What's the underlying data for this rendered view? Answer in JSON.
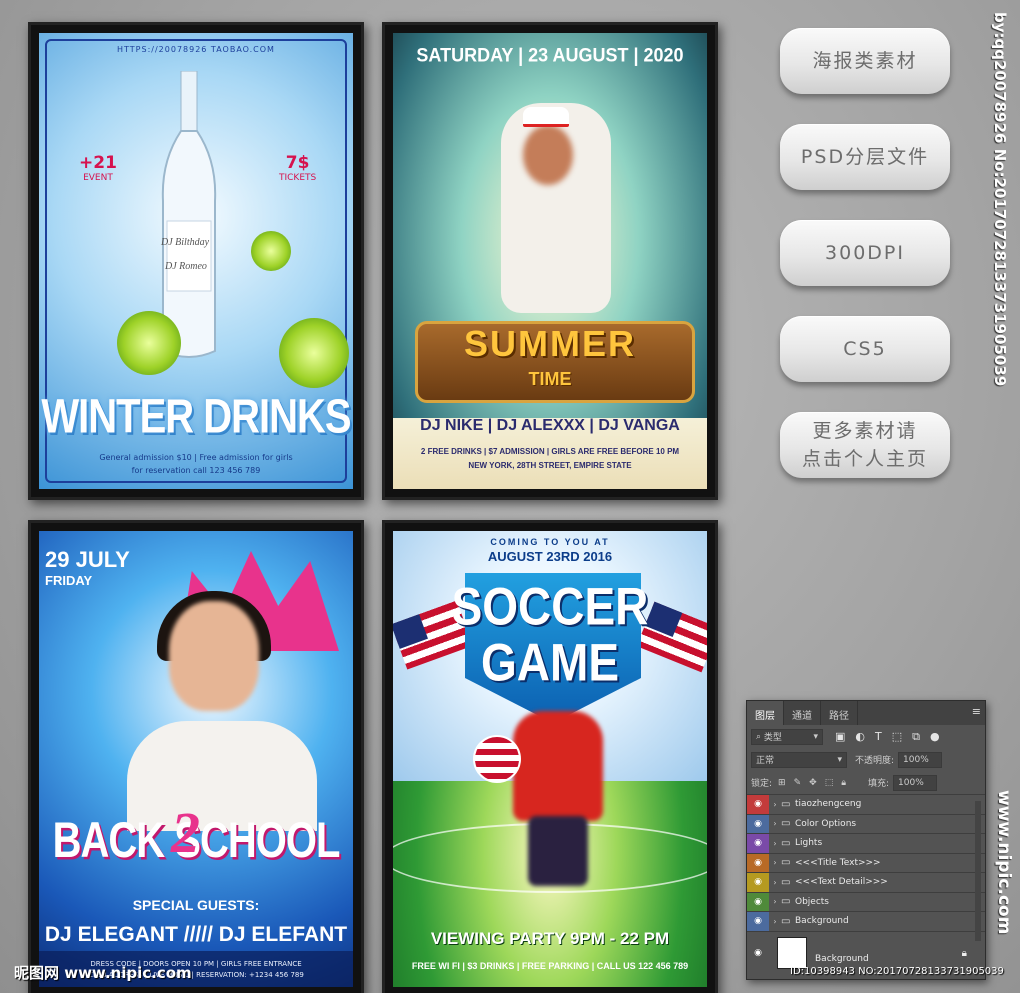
{
  "posters": {
    "winter": {
      "url": "HTTPS://20078926 TAOBAO.COM",
      "left_top": "+21",
      "left_bottom": "EVENT",
      "right_top": "7$",
      "right_bottom": "TICKETS",
      "bottle_line1": "DJ Bilthday",
      "bottle_line2": "DJ Romeo",
      "title": "WINTER DRINKS",
      "info1": "General admission $10 | Free admission for girls",
      "info2": "for reservation call 123 456 789"
    },
    "summer": {
      "date": "SATURDAY | 23 AUGUST | 2020",
      "word1": "SUMMER",
      "word2": "TIME",
      "djs": "DJ NIKE | DJ ALEXXX | DJ VANGA",
      "info1": "2 FREE DRINKS | $7 ADMISSION | GIRLS ARE FREE BEFORE 10 PM",
      "info2": "NEW YORK, 28TH STREET, EMPIRE STATE"
    },
    "school": {
      "date": "29 JULY",
      "day": "FRIDAY",
      "title": "BACK SCHOOL",
      "two": "2",
      "guests": "SPECIAL GUESTS:",
      "djs": "DJ ELEGANT ///// DJ ELEFANT",
      "info1": "DRESS CODE | DOORS OPEN 10 PM | GIRLS FREE ENTRANCE",
      "info2": "CLUB ADDRESS | LIVE MUSIC | RESERVATION: +1234 456 789"
    },
    "soccer": {
      "coming": "COMING TO YOU AT",
      "date": "AUGUST 23RD 2016",
      "word1": "SOCCER",
      "word2": "GAME",
      "viewing": "VIEWING PARTY 9PM - 22 PM",
      "info": "FREE WI FI | $3 DRINKS | FREE PARKING | CALL US 122 456 789"
    }
  },
  "buttons": [
    "海报类素材",
    "PSD分层文件",
    "300DPI",
    "CS5",
    "更多素材请\n点击个人主页"
  ],
  "side_text": "by:qq20078926 No:20170728133731905039",
  "layers_panel": {
    "tabs": [
      "图层",
      "通道",
      "路径"
    ],
    "filter_label": "类型",
    "blend_mode": "正常",
    "opacity_label": "不透明度:",
    "opacity_value": "100%",
    "lock_label": "锁定:",
    "fill_label": "填充:",
    "fill_value": "100%",
    "layers": [
      {
        "name": "tiaozhengceng",
        "color": "#c33b3b"
      },
      {
        "name": "Color Options",
        "color": "#4c6b9e"
      },
      {
        "name": "Lights",
        "color": "#7a4aa8"
      },
      {
        "name": "<<<Title Text>>>",
        "color": "#b86a26"
      },
      {
        "name": "<<<Text Detail>>>",
        "color": "#b59a20"
      },
      {
        "name": "Objects",
        "color": "#4f8a3a"
      },
      {
        "name": "Background",
        "color": "#4c6b9e"
      }
    ],
    "base_layer": "Background"
  },
  "watermarks": {
    "left": "昵图网 www.nipic.com",
    "right": "www.nipic.com",
    "id": "ID:10398943 NO:20170728133731905039"
  }
}
